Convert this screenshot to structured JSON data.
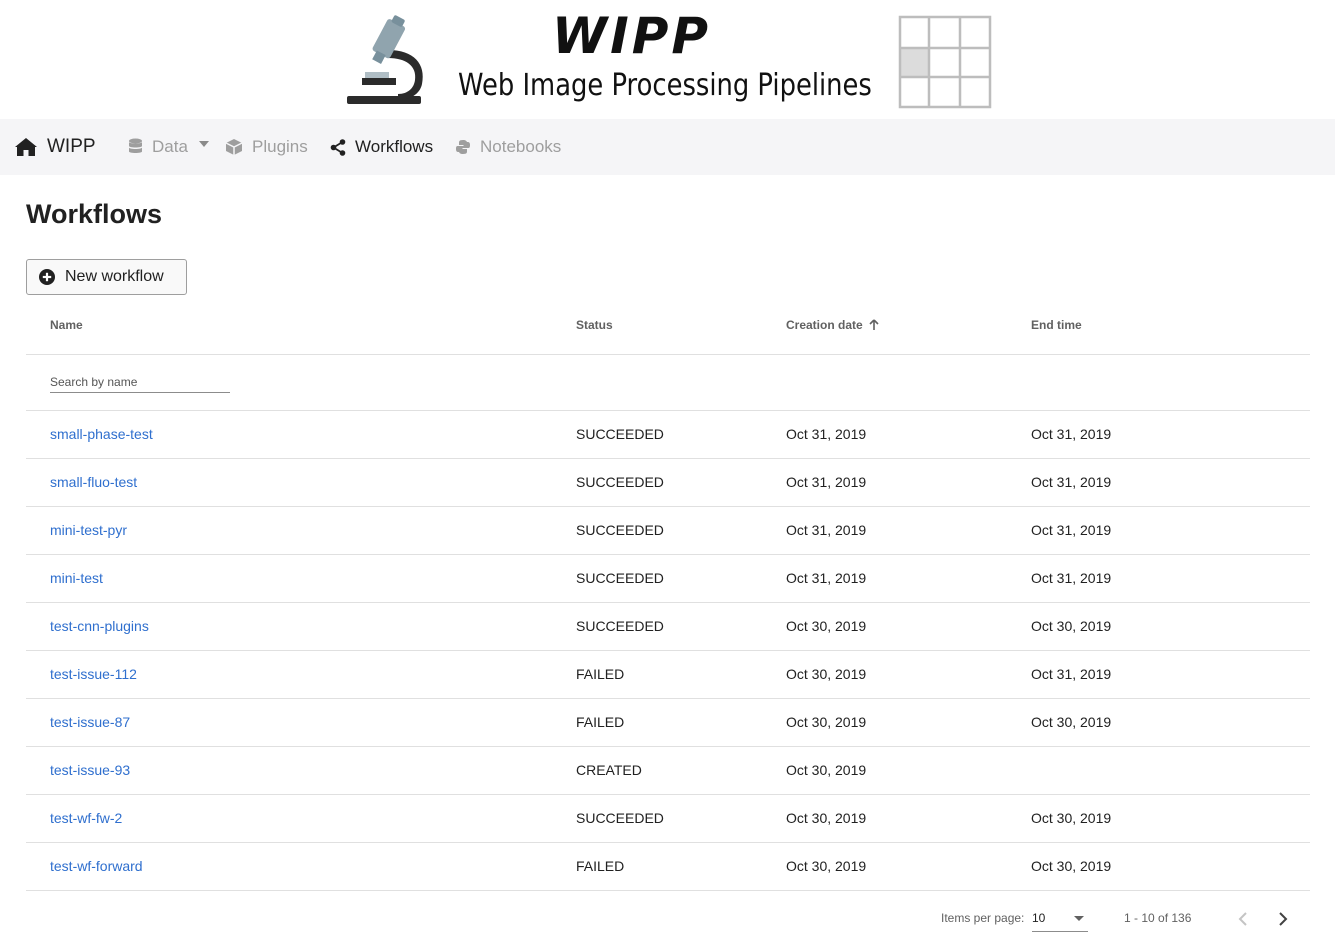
{
  "banner": {
    "title": "WIPP",
    "subtitle": "Web Image Processing Pipelines"
  },
  "nav": {
    "brand": "WIPP",
    "items": [
      {
        "label": "Data",
        "icon": "database-icon"
      },
      {
        "label": "Plugins",
        "icon": "cube-icon"
      },
      {
        "label": "Workflows",
        "icon": "share-icon",
        "active": true
      },
      {
        "label": "Notebooks",
        "icon": "python-icon"
      }
    ]
  },
  "page": {
    "title": "Workflows",
    "new_button": "New workflow"
  },
  "table": {
    "columns": {
      "name": "Name",
      "status": "Status",
      "created": "Creation date",
      "end": "End time"
    },
    "sort": {
      "column": "created",
      "direction": "asc"
    },
    "search_placeholder": "Search by name",
    "rows": [
      {
        "name": "small-phase-test",
        "status": "SUCCEEDED",
        "created": "Oct 31, 2019",
        "end": "Oct 31, 2019"
      },
      {
        "name": "small-fluo-test",
        "status": "SUCCEEDED",
        "created": "Oct 31, 2019",
        "end": "Oct 31, 2019"
      },
      {
        "name": "mini-test-pyr",
        "status": "SUCCEEDED",
        "created": "Oct 31, 2019",
        "end": "Oct 31, 2019"
      },
      {
        "name": "mini-test",
        "status": "SUCCEEDED",
        "created": "Oct 31, 2019",
        "end": "Oct 31, 2019"
      },
      {
        "name": "test-cnn-plugins",
        "status": "SUCCEEDED",
        "created": "Oct 30, 2019",
        "end": "Oct 30, 2019"
      },
      {
        "name": "test-issue-112",
        "status": "FAILED",
        "created": "Oct 30, 2019",
        "end": "Oct 31, 2019"
      },
      {
        "name": "test-issue-87",
        "status": "FAILED",
        "created": "Oct 30, 2019",
        "end": "Oct 30, 2019"
      },
      {
        "name": "test-issue-93",
        "status": "CREATED",
        "created": "Oct 30, 2019",
        "end": ""
      },
      {
        "name": "test-wf-fw-2",
        "status": "SUCCEEDED",
        "created": "Oct 30, 2019",
        "end": "Oct 30, 2019"
      },
      {
        "name": "test-wf-forward",
        "status": "FAILED",
        "created": "Oct 30, 2019",
        "end": "Oct 30, 2019"
      }
    ]
  },
  "paginator": {
    "items_per_page_label": "Items per page:",
    "items_per_page": "10",
    "range": "1 - 10 of 136"
  },
  "colors": {
    "link": "#2f6fce",
    "navbar_bg": "#f5f5f7",
    "inactive_nav": "#9e9e9e"
  }
}
